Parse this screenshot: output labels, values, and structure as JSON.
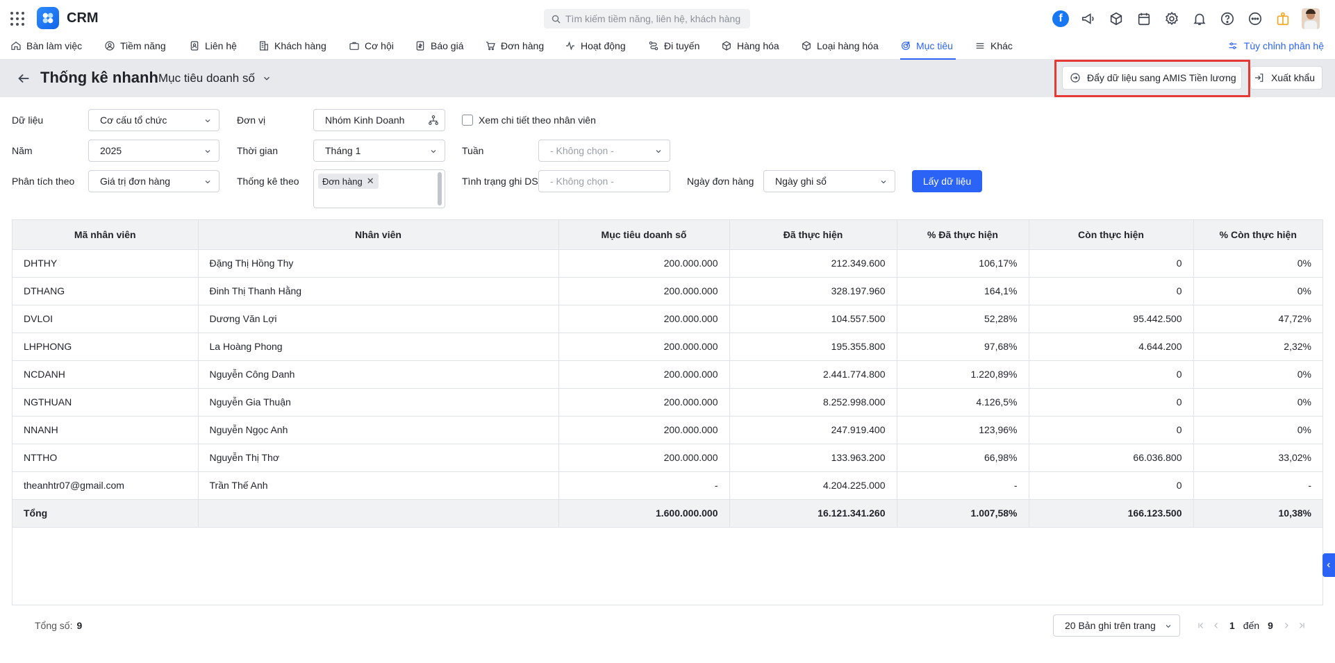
{
  "app": {
    "title": "CRM"
  },
  "search": {
    "placeholder": "Tìm kiếm tiềm năng, liên hệ, khách hàng"
  },
  "nav": {
    "items": [
      {
        "label": "Bàn làm việc"
      },
      {
        "label": "Tiềm năng"
      },
      {
        "label": "Liên hệ"
      },
      {
        "label": "Khách hàng"
      },
      {
        "label": "Cơ hội"
      },
      {
        "label": "Báo giá"
      },
      {
        "label": "Đơn hàng"
      },
      {
        "label": "Hoạt động"
      },
      {
        "label": "Đi tuyến"
      },
      {
        "label": "Hàng hóa"
      },
      {
        "label": "Loại hàng hóa"
      },
      {
        "label": "Mục tiêu"
      },
      {
        "label": "Khác"
      }
    ],
    "active": "Mục tiêu",
    "customize_label": "Tùy chỉnh phân hệ"
  },
  "page": {
    "title": "Thống kê nhanh",
    "report_name": "Mục tiêu doanh số",
    "push_button_label": "Đẩy dữ liệu sang AMIS Tiền lương",
    "export_button_label": "Xuất khẩu"
  },
  "filters": {
    "data_label": "Dữ liệu",
    "data_value": "Cơ cấu tổ chức",
    "unit_label": "Đơn vị",
    "unit_value": "Nhóm Kinh Doanh",
    "detail_checkbox_label": "Xem chi tiết theo nhân viên",
    "detail_checked": false,
    "year_label": "Năm",
    "year_value": "2025",
    "time_label": "Thời gian",
    "time_value": "Tháng 1",
    "week_label": "Tuần",
    "week_value": "- Không chọn -",
    "analyze_label": "Phân tích theo",
    "analyze_value": "Giá trị đơn hàng",
    "stat_label": "Thống kê theo",
    "stat_chip": "Đơn hàng",
    "status_label": "Tình trạng ghi DS",
    "status_value": "- Không chọn -",
    "order_date_label": "Ngày đơn hàng",
    "order_date_value": "Ngày ghi sổ",
    "get_data_label": "Lấy dữ liệu"
  },
  "table": {
    "columns": [
      "Mã nhân viên",
      "Nhân viên",
      "Mục tiêu doanh số",
      "Đã thực hiện",
      "% Đã thực hiện",
      "Còn thực hiện",
      "% Còn thực hiện"
    ],
    "rows": [
      [
        "DHTHY",
        "Đặng Thị Hồng Thy",
        "200.000.000",
        "212.349.600",
        "106,17%",
        "0",
        "0%"
      ],
      [
        "DTHANG",
        "Đinh Thị Thanh Hằng",
        "200.000.000",
        "328.197.960",
        "164,1%",
        "0",
        "0%"
      ],
      [
        "DVLOI",
        "Dương Văn Lợi",
        "200.000.000",
        "104.557.500",
        "52,28%",
        "95.442.500",
        "47,72%"
      ],
      [
        "LHPHONG",
        "La Hoàng Phong",
        "200.000.000",
        "195.355.800",
        "97,68%",
        "4.644.200",
        "2,32%"
      ],
      [
        "NCDANH",
        "Nguyễn Công Danh",
        "200.000.000",
        "2.441.774.800",
        "1.220,89%",
        "0",
        "0%"
      ],
      [
        "NGTHUAN",
        "Nguyễn Gia Thuận",
        "200.000.000",
        "8.252.998.000",
        "4.126,5%",
        "0",
        "0%"
      ],
      [
        "NNANH",
        "Nguyễn Ngọc Anh",
        "200.000.000",
        "247.919.400",
        "123,96%",
        "0",
        "0%"
      ],
      [
        "NTTHO",
        "Nguyễn Thị Thơ",
        "200.000.000",
        "133.963.200",
        "66,98%",
        "66.036.800",
        "33,02%"
      ],
      [
        "theanhtr07@gmail.com",
        "Trần Thế Anh",
        "-",
        "4.204.225.000",
        "-",
        "0",
        "-"
      ]
    ],
    "total": [
      "Tổng",
      "",
      "1.600.000.000",
      "16.121.341.260",
      "1.007,58%",
      "166.123.500",
      "10,38%"
    ]
  },
  "footer": {
    "total_label": "Tổng số:",
    "total_value": "9",
    "page_size_label": "20 Bản ghi trên trang",
    "page_from": "1",
    "page_sep": "đến",
    "page_to": "9"
  },
  "colors": {
    "accent": "#2a63f6",
    "highlight": "#e53935",
    "header_bg": "#e8e9ec"
  }
}
